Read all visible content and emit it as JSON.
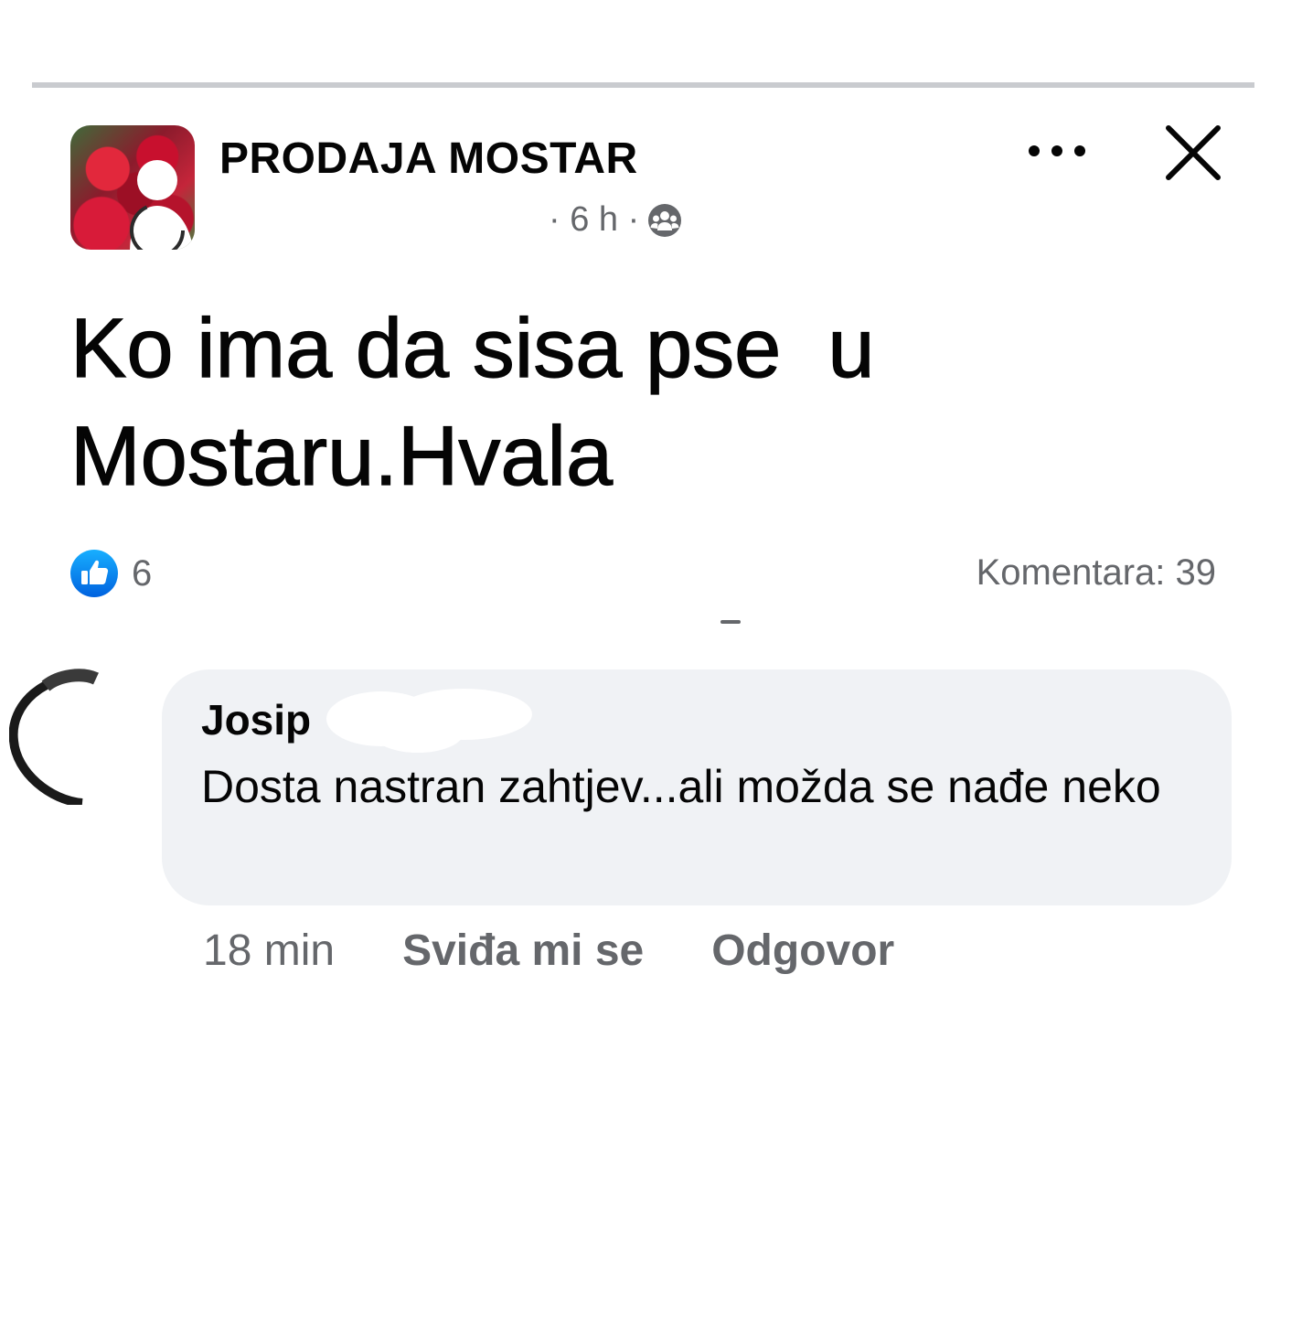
{
  "post": {
    "group_name": "PRODAJA MOSTAR",
    "meta": {
      "time": "· 6 h ·",
      "privacy_icon": "group-members-icon"
    },
    "text_line1": "Ko ima da sisa pse  u",
    "text_line2": "Mostaru.Hvala",
    "reactions": {
      "icon": "like-icon",
      "count": "6",
      "color": "#1877f2"
    },
    "comments_label": "Komentara: 39"
  },
  "comment": {
    "author": "Josip",
    "text": "Dosta nastran zahtjev...ali možda se nađe neko",
    "time": "18 min",
    "like_label": "Sviđa mi se",
    "reply_label": "Odgovor"
  },
  "colors": {
    "secondary_text": "#65676b",
    "bubble_bg": "#f0f2f5",
    "divider": "#c9cbcf"
  }
}
